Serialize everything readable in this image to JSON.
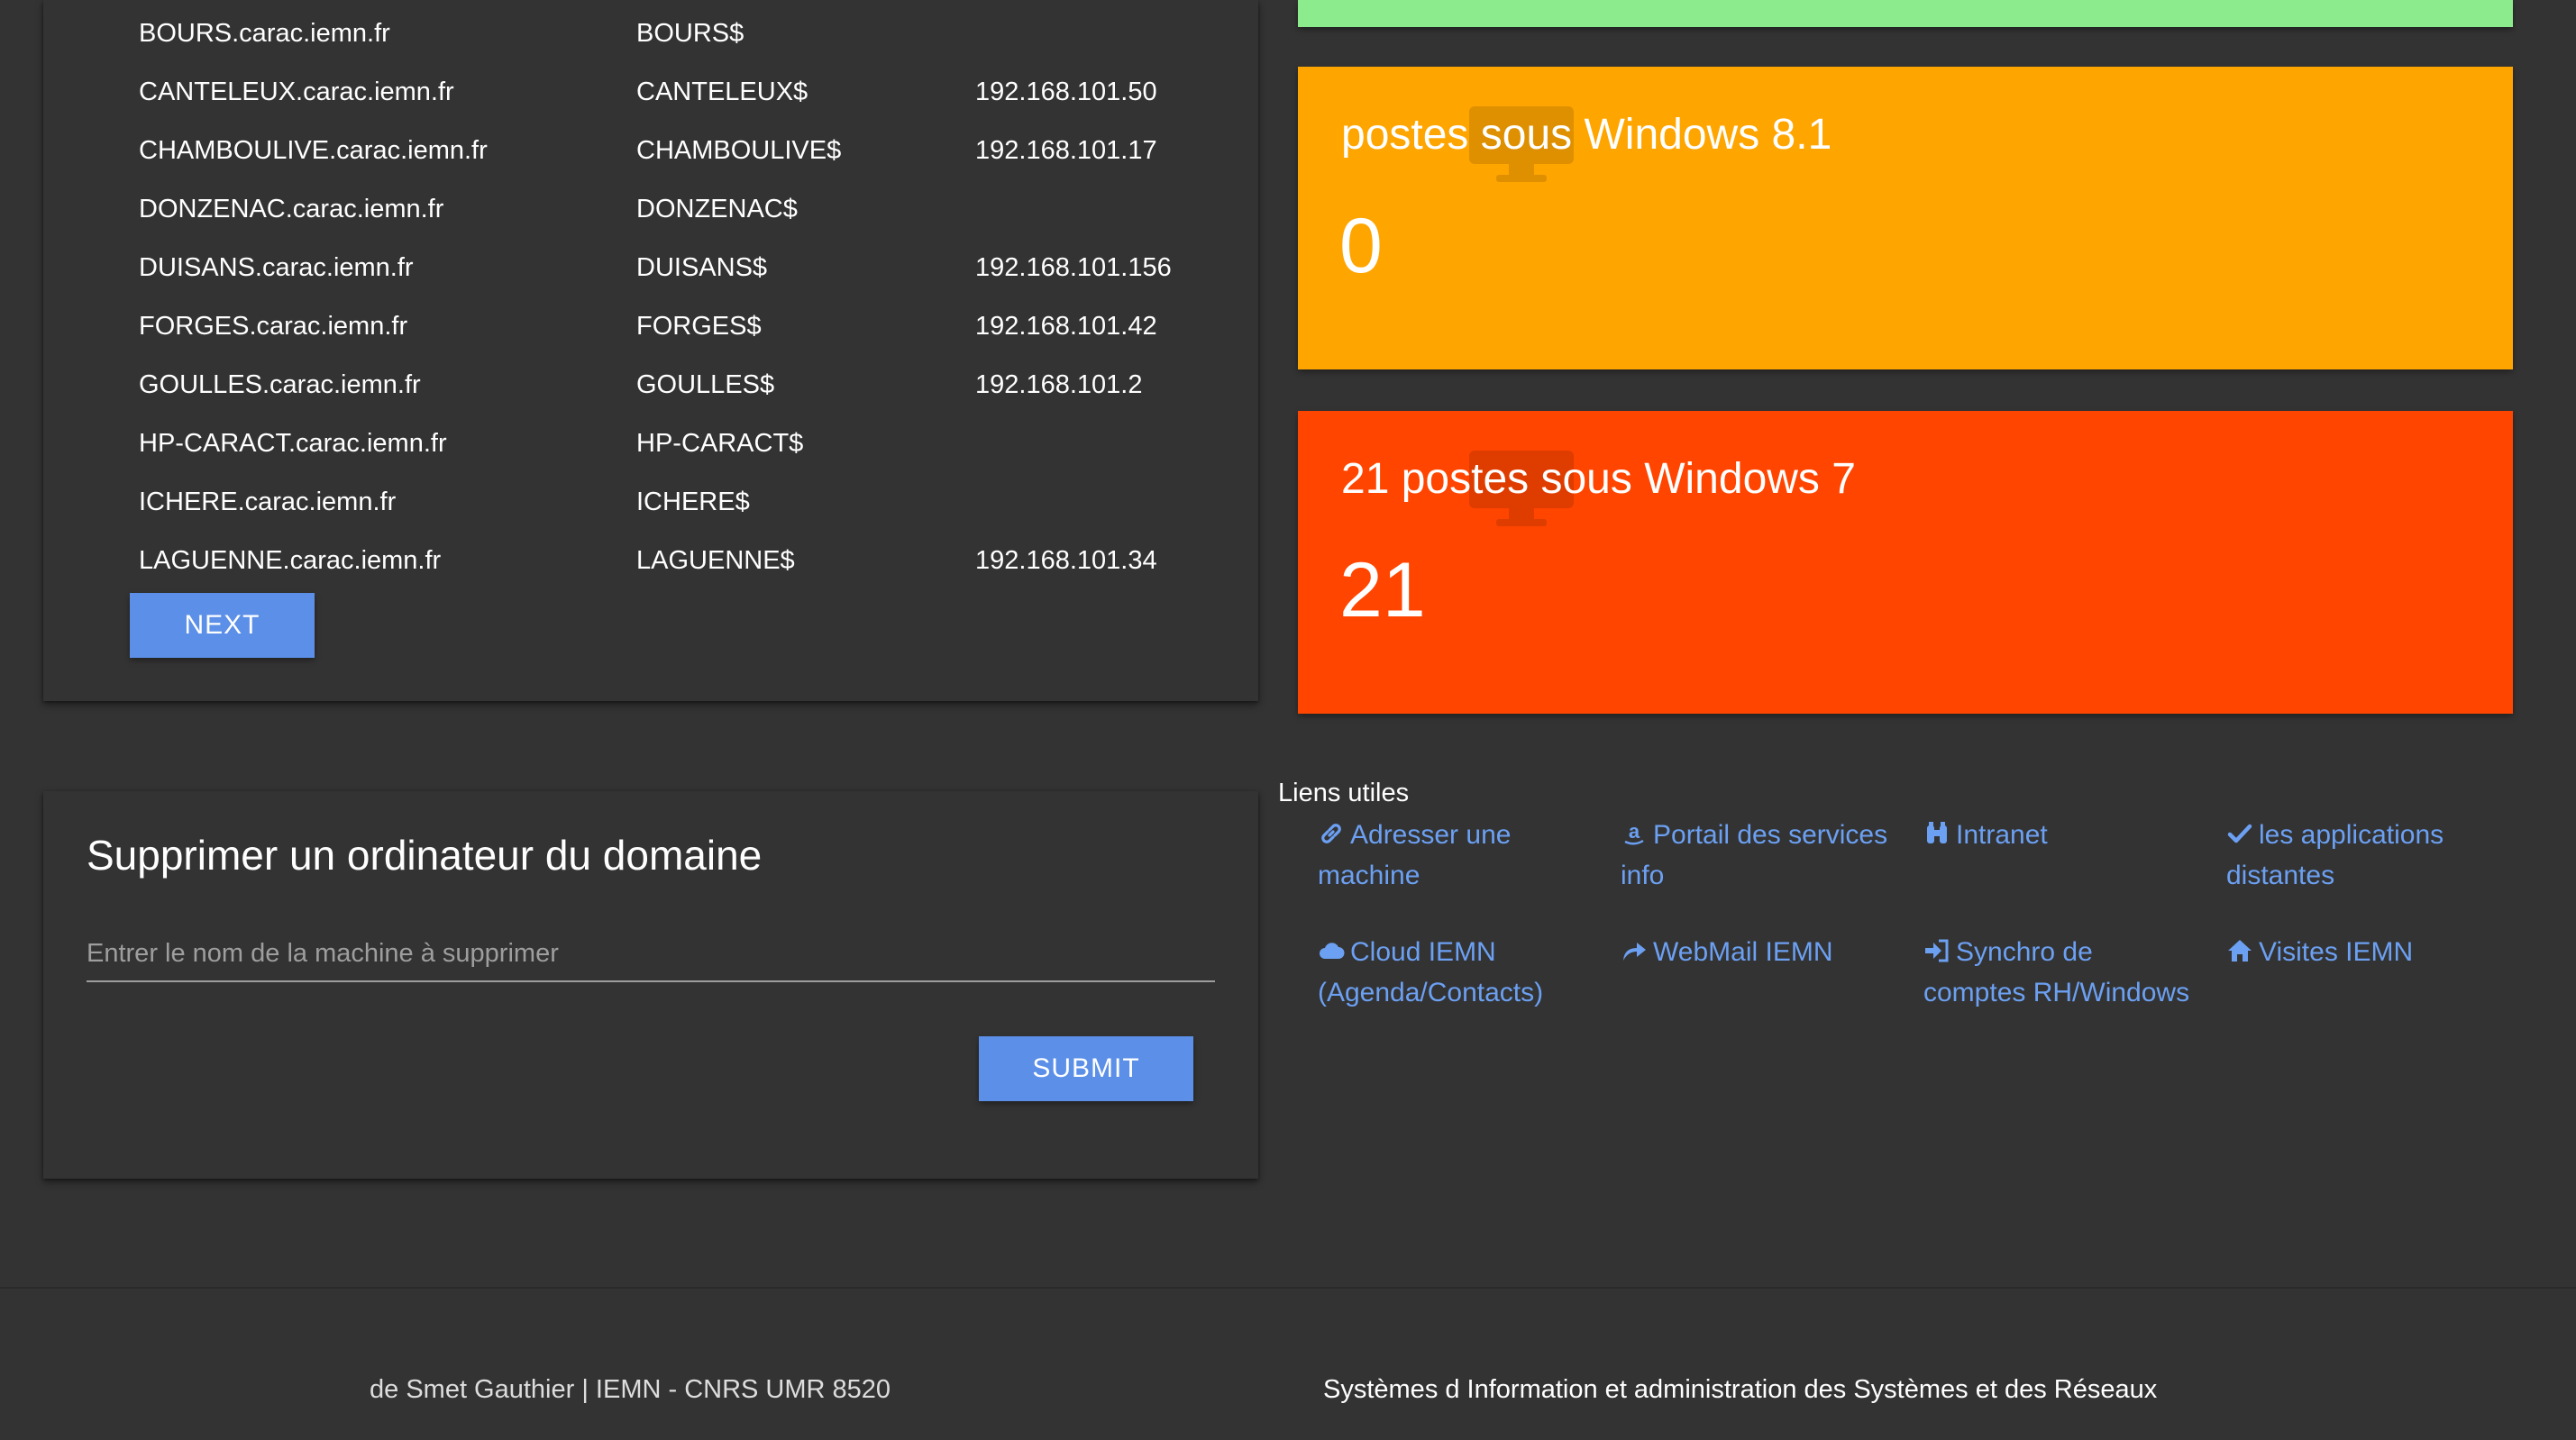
{
  "computers_table": {
    "rows": [
      {
        "dns_name": "BOURS.carac.iemn.fr",
        "sam_name": "BOURS$",
        "ip": ""
      },
      {
        "dns_name": "CANTELEUX.carac.iemn.fr",
        "sam_name": "CANTELEUX$",
        "ip": "192.168.101.50"
      },
      {
        "dns_name": "CHAMBOULIVE.carac.iemn.fr",
        "sam_name": "CHAMBOULIVE$",
        "ip": "192.168.101.17"
      },
      {
        "dns_name": "DONZENAC.carac.iemn.fr",
        "sam_name": "DONZENAC$",
        "ip": ""
      },
      {
        "dns_name": "DUISANS.carac.iemn.fr",
        "sam_name": "DUISANS$",
        "ip": "192.168.101.156"
      },
      {
        "dns_name": "FORGES.carac.iemn.fr",
        "sam_name": "FORGES$",
        "ip": "192.168.101.42"
      },
      {
        "dns_name": "GOULLES.carac.iemn.fr",
        "sam_name": "GOULLES$",
        "ip": "192.168.101.2"
      },
      {
        "dns_name": "HP-CARACT.carac.iemn.fr",
        "sam_name": "HP-CARACT$",
        "ip": ""
      },
      {
        "dns_name": "ICHERE.carac.iemn.fr",
        "sam_name": "ICHERE$",
        "ip": ""
      },
      {
        "dns_name": "LAGUENNE.carac.iemn.fr",
        "sam_name": "LAGUENNE$",
        "ip": "192.168.101.34"
      }
    ],
    "next_label": "NEXT"
  },
  "delete_form": {
    "title": "Supprimer un ordinateur du domaine",
    "placeholder": "Entrer le nom de la machine à supprimer",
    "submit_label": "SUBMIT"
  },
  "cards": {
    "win81": {
      "title": "postes sous Windows 8.1",
      "count": "0",
      "color": "#ffa500",
      "icon": "desktop-icon"
    },
    "win7": {
      "title": "21 postes sous Windows 7",
      "count": "21",
      "color": "#ff4500",
      "icon": "desktop-icon"
    },
    "top": {
      "color": "#8ceb8c"
    }
  },
  "links": {
    "title": "Liens utiles",
    "items": [
      {
        "label": "Adresser une machine",
        "icon": "link-icon"
      },
      {
        "label": "Portail des services info",
        "icon": "amazon-icon"
      },
      {
        "label": "Intranet",
        "icon": "binoculars-icon"
      },
      {
        "label": "les applications distantes",
        "icon": "check-icon"
      },
      {
        "label": "Cloud IEMN (Agenda/Contacts)",
        "icon": "cloud-icon"
      },
      {
        "label": "WebMail IEMN",
        "icon": "share-icon"
      },
      {
        "label": "Synchro de comptes RH/Windows",
        "icon": "sign-in-icon"
      },
      {
        "label": "Visites IEMN",
        "icon": "home-icon"
      }
    ],
    "color": "#6ca0f2"
  },
  "footer": {
    "left": "de Smet Gauthier | IEMN - CNRS UMR 8520",
    "right": "Systèmes d Information et administration des Systèmes et des Réseaux"
  }
}
